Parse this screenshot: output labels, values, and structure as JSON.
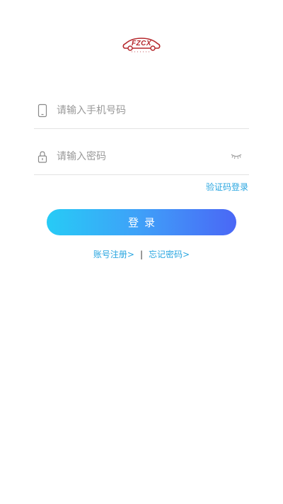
{
  "logo": {
    "text": "FZCX",
    "color": "#b5262b"
  },
  "form": {
    "phone_placeholder": "请输入手机号码",
    "password_placeholder": "请输入密码",
    "phone_icon": "phone-icon",
    "lock_icon": "lock-icon",
    "eye_icon": "eye-closed-icon"
  },
  "sms_login_label": "验证码登录",
  "login_button_label": "登录",
  "links": {
    "register_label": "账号注册>",
    "separator": "|",
    "forgot_label": "忘记密码>"
  },
  "colors": {
    "link": "#29a6e0",
    "button_gradient_start": "#27cbf6",
    "button_gradient_end": "#4a67f6"
  }
}
